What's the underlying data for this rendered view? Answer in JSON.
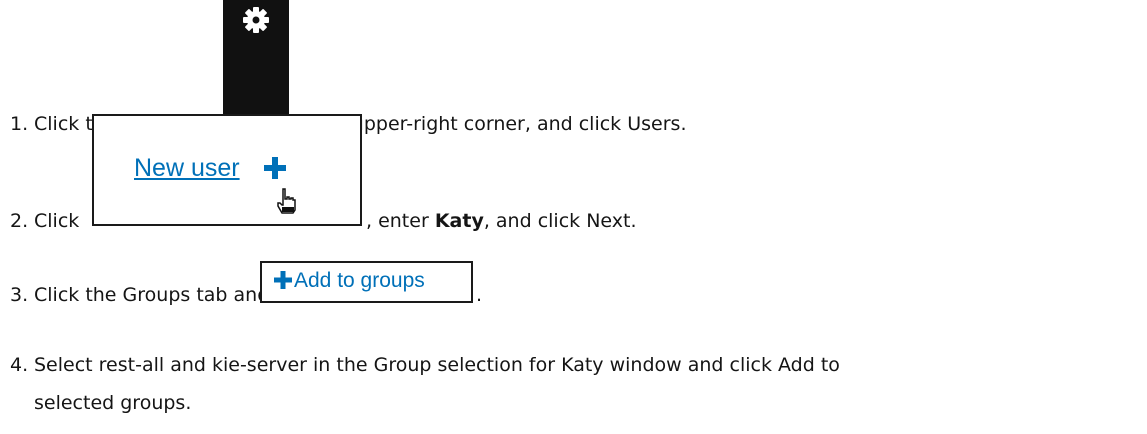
{
  "steps": [
    {
      "number": "1.",
      "text_before_icon": "Click the gear icon",
      "text_after_icon": " in the upper-right corner, and click ",
      "target": "Users",
      "end": ".",
      "icon": "gear-icon"
    },
    {
      "number": "2.",
      "prefix": "Click",
      "screenshot_label": "New user",
      "screenshot_icons": [
        "plus-icon",
        "hand-cursor-icon"
      ],
      "text_after": ", enter ",
      "value": "Katy",
      "text_mid": ", and click ",
      "target": "Next",
      "end": "."
    },
    {
      "number": "3.",
      "prefix": "Click the ",
      "tab": "Groups",
      "text_mid": " tab and click",
      "screenshot_label": "Add to groups",
      "screenshot_icon": "plus-icon",
      "end": "."
    },
    {
      "number": "4.",
      "prefix": "Select ",
      "group_a": "rest-all",
      "and": " and ",
      "group_b": "kie-server",
      "text_mid": " in the ",
      "window": "Group selection for Katy",
      "text_mid2": " window and click ",
      "target_part1": "Add to",
      "target_part2": "selected groups",
      "end": "."
    }
  ],
  "colors": {
    "text": "#151515",
    "link": "#0070b8",
    "icon_background": "#111111"
  }
}
